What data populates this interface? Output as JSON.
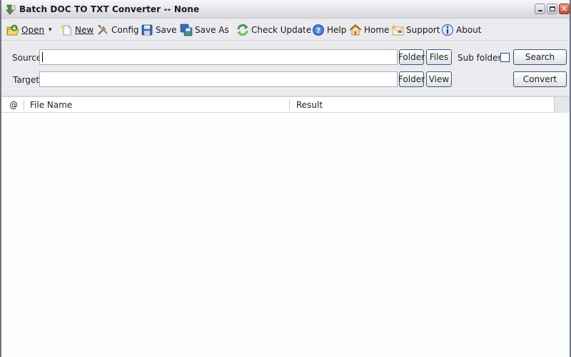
{
  "window": {
    "title": "Batch DOC TO TXT Converter -- None",
    "controls": {
      "minimize": "–",
      "maximize": "□",
      "close": "✕"
    }
  },
  "toolbar": {
    "items": [
      {
        "id": "open",
        "label": "Open",
        "icon": "open-folder-icon",
        "has_dropdown": true
      },
      {
        "id": "new",
        "label": "New",
        "icon": "new-document-icon"
      },
      {
        "id": "config",
        "label": "Config",
        "icon": "tools-icon"
      },
      {
        "id": "save",
        "label": "Save",
        "icon": "floppy-disk-icon"
      },
      {
        "id": "save_as",
        "label": "Save As",
        "icon": "save-as-icon"
      },
      {
        "id": "check_update",
        "label": "Check Update",
        "icon": "refresh-arrows-icon"
      },
      {
        "id": "help",
        "label": "Help",
        "icon": "help-icon"
      },
      {
        "id": "home",
        "label": "Home",
        "icon": "home-icon"
      },
      {
        "id": "support",
        "label": "Support",
        "icon": "support-envelope-icon"
      },
      {
        "id": "about",
        "label": "About",
        "icon": "info-icon"
      }
    ],
    "dropdown_glyph": "▾"
  },
  "form": {
    "source": {
      "label": "Source",
      "value": "",
      "folder_button": "Folder",
      "files_button": "Files"
    },
    "target": {
      "label": "Target",
      "value": "",
      "folder_button": "Folder",
      "view_button": "View"
    },
    "subfolders": {
      "label": "Sub folders",
      "checked": false
    },
    "search_button": "Search",
    "convert_button": "Convert"
  },
  "list": {
    "columns": [
      "@",
      "File Name",
      "Result"
    ],
    "rows": []
  }
}
